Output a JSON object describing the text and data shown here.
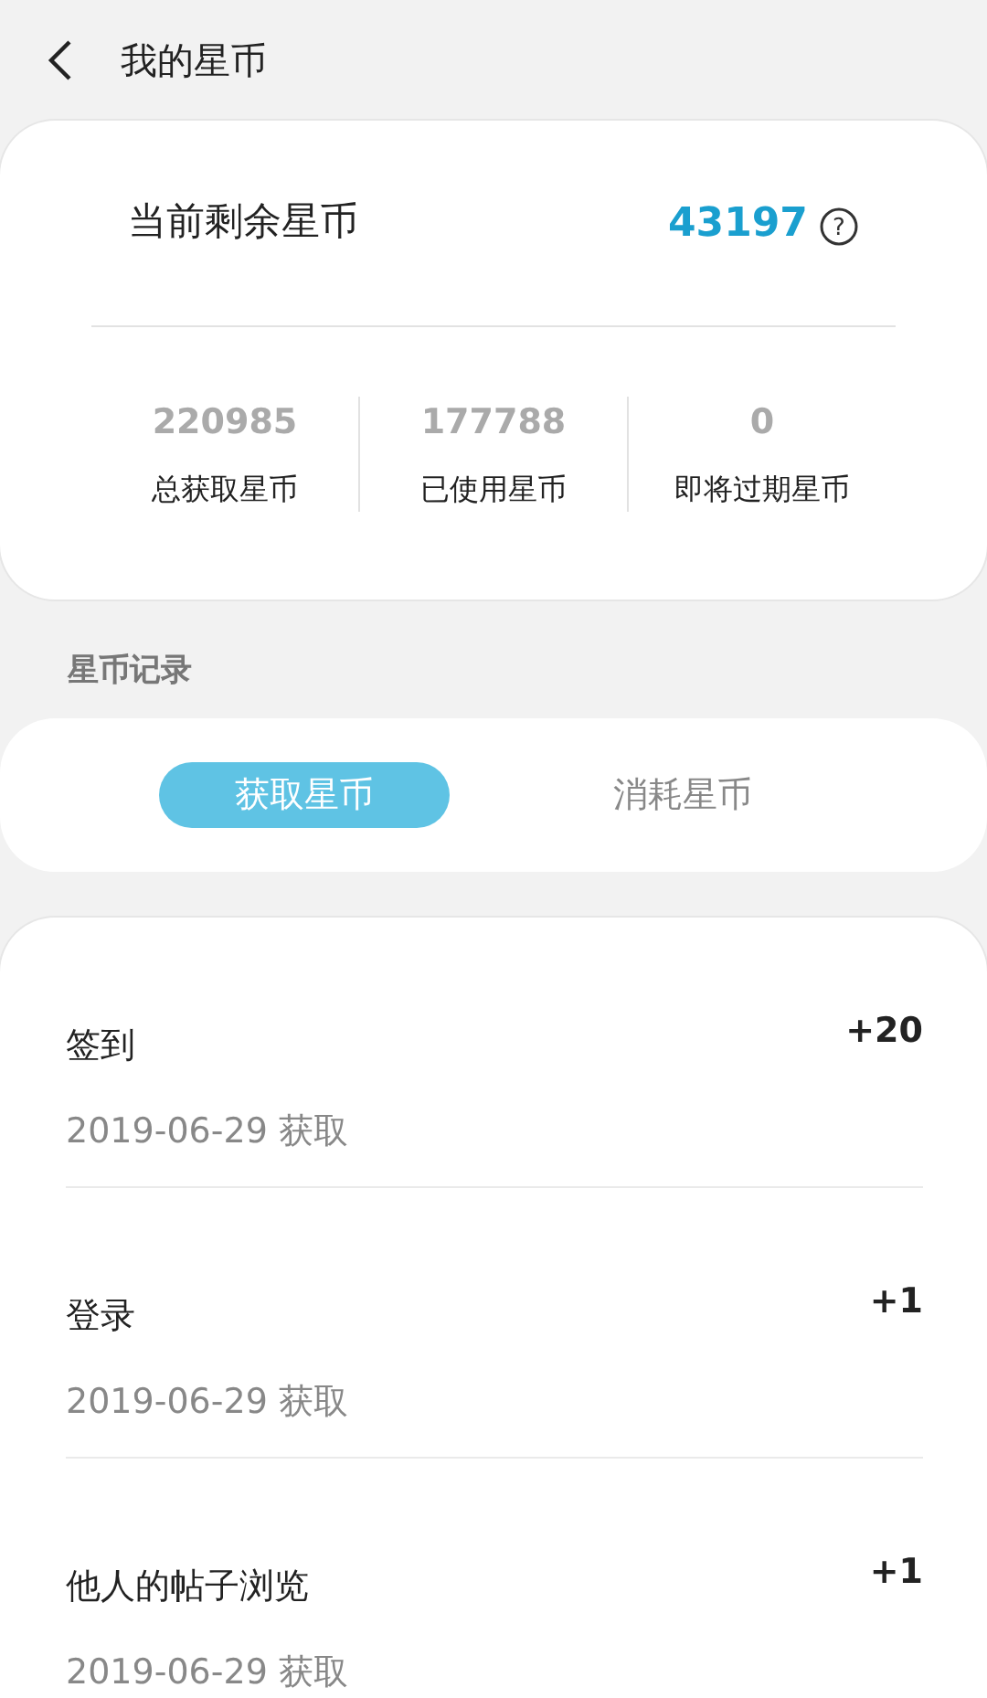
{
  "header": {
    "title": "我的星币"
  },
  "summary": {
    "label": "当前剩余星币",
    "value": "43197",
    "help": "?",
    "stats": [
      {
        "value": "220985",
        "label": "总获取星币"
      },
      {
        "value": "177788",
        "label": "已使用星币"
      },
      {
        "value": "0",
        "label": "即将过期星币"
      }
    ]
  },
  "section_title": "星币记录",
  "tabs": [
    {
      "label": "获取星币",
      "selected": true
    },
    {
      "label": "消耗星币",
      "selected": false
    }
  ],
  "records": [
    {
      "title": "签到",
      "amount": "+20",
      "date": "2019-06-29 获取"
    },
    {
      "title": "登录",
      "amount": "+1",
      "date": "2019-06-29 获取"
    },
    {
      "title": "他人的帖子浏览",
      "amount": "+1",
      "date": "2019-06-29 获取"
    }
  ]
}
